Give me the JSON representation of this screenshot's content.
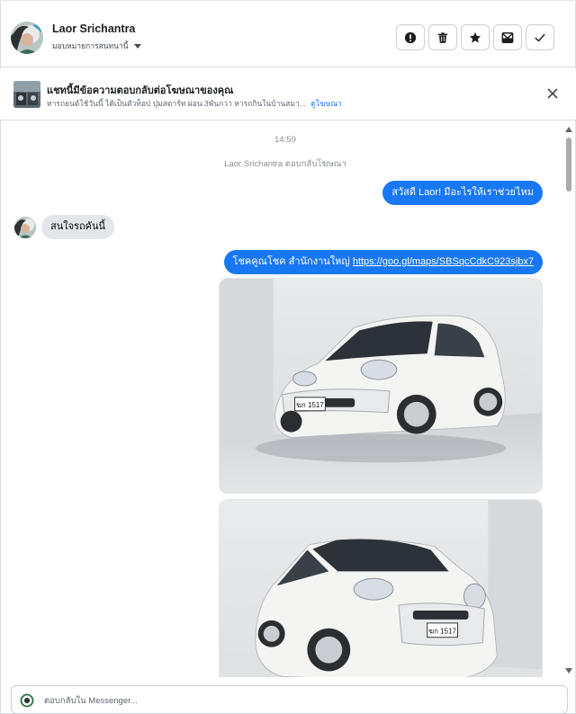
{
  "header": {
    "contact_name": "Laor Srichantra",
    "assign_label": "มอบหมายการสนทนานี้",
    "actions": [
      {
        "name": "mark-spam-button",
        "icon": "exclamation-icon"
      },
      {
        "name": "delete-button",
        "icon": "trash-icon"
      },
      {
        "name": "star-button",
        "icon": "star-icon"
      },
      {
        "name": "mark-unread-button",
        "icon": "envelope-icon"
      },
      {
        "name": "mark-done-button",
        "icon": "check-icon"
      }
    ]
  },
  "ad_banner": {
    "title": "แชทนี้มีข้อความตอบกลับต่อโฆษณาของคุณ",
    "subtitle": "หารถยนต์ใช้วันนี้ ได้เป็นตัวท็อป ปุ่มสตาร์ท ผ่อน 3พันกว่า หารถกินในบ้านสมา...",
    "link_label": "ดูโฆษณา"
  },
  "chat": {
    "timestamp": "14:59",
    "replied_notice": "Laor Srichantra ตอบกลับโฆษณา",
    "messages": [
      {
        "direction": "out",
        "text": "สวัสดี Laor! มีอะไรให้เราช่วยไหม"
      },
      {
        "direction": "in",
        "text": "สนใจรถคันนี้"
      },
      {
        "direction": "out",
        "prefix": "โชคคูณโชค สำนักงานใหญ่ ",
        "url": "https://goo.gl/maps/SBSqcCdkC923sjbx7"
      }
    ],
    "photos": [
      {
        "plate": "ฆก 1517"
      },
      {
        "plate": "ฆก 1517"
      }
    ]
  },
  "composer": {
    "placeholder": "ตอบกลับใน Messenger..."
  },
  "colors": {
    "accent": "#1877f2",
    "incoming_bubble": "#e4e6eb",
    "border": "#dadde1"
  }
}
